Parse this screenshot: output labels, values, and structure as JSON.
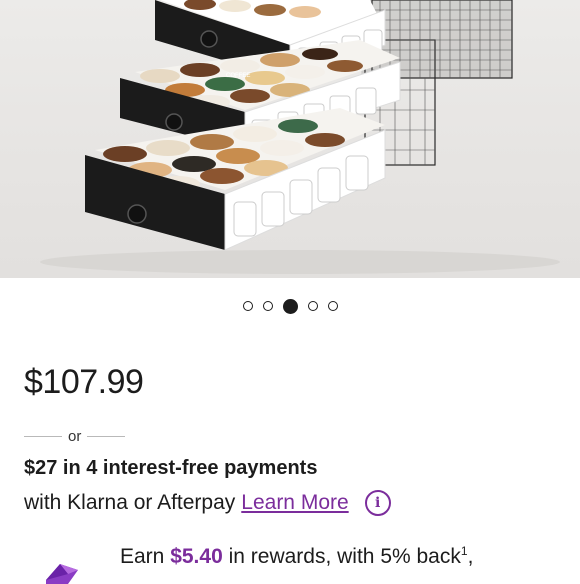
{
  "product_image": {
    "pod_label": "COFFEE"
  },
  "carousel": {
    "count": 5,
    "active_index": 2
  },
  "price": {
    "amount": "$107.99"
  },
  "financing": {
    "or_text": "or",
    "installments": "$27 in 4 interest-free payments",
    "provider_text": "with Klarna or Afterpay",
    "learn_more": "Learn More",
    "info_glyph": "i"
  },
  "rewards": {
    "prefix": "Earn ",
    "amount": "$5.40",
    "middle": " in rewards, with 5% back",
    "footnote": "1",
    "suffix": ","
  },
  "colors": {
    "accent": "#7b2d9c",
    "text": "#1c1c1c"
  },
  "icons": [
    "info-icon",
    "rewards-gem-icon"
  ]
}
